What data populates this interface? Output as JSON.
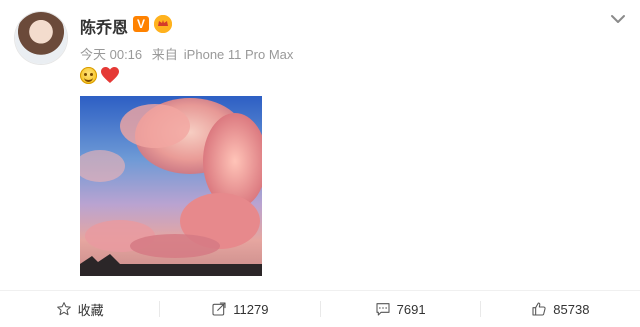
{
  "post": {
    "author_name": "陈乔恩",
    "verified_badge_text": "V",
    "vip_badge_text": "👑",
    "time": "今天 00:16",
    "source_prefix": "来自",
    "source_device": "iPhone 11 Pro Max"
  },
  "actions": {
    "favorite_label": "收藏",
    "repost_count": "11279",
    "comment_count": "7691",
    "like_count": "85738"
  },
  "colors": {
    "accent_orange": "#ff8200",
    "meta_gray": "#999999",
    "text_dark": "#333333"
  },
  "icons": {
    "verified": "verified-icon",
    "vip": "vip-icon",
    "menu": "chevron-down-icon",
    "favorite": "star-icon",
    "repost": "repost-icon",
    "comment": "comment-icon",
    "like": "like-icon",
    "emoji1": "smile-emoji",
    "emoji2": "heart-emoji"
  }
}
